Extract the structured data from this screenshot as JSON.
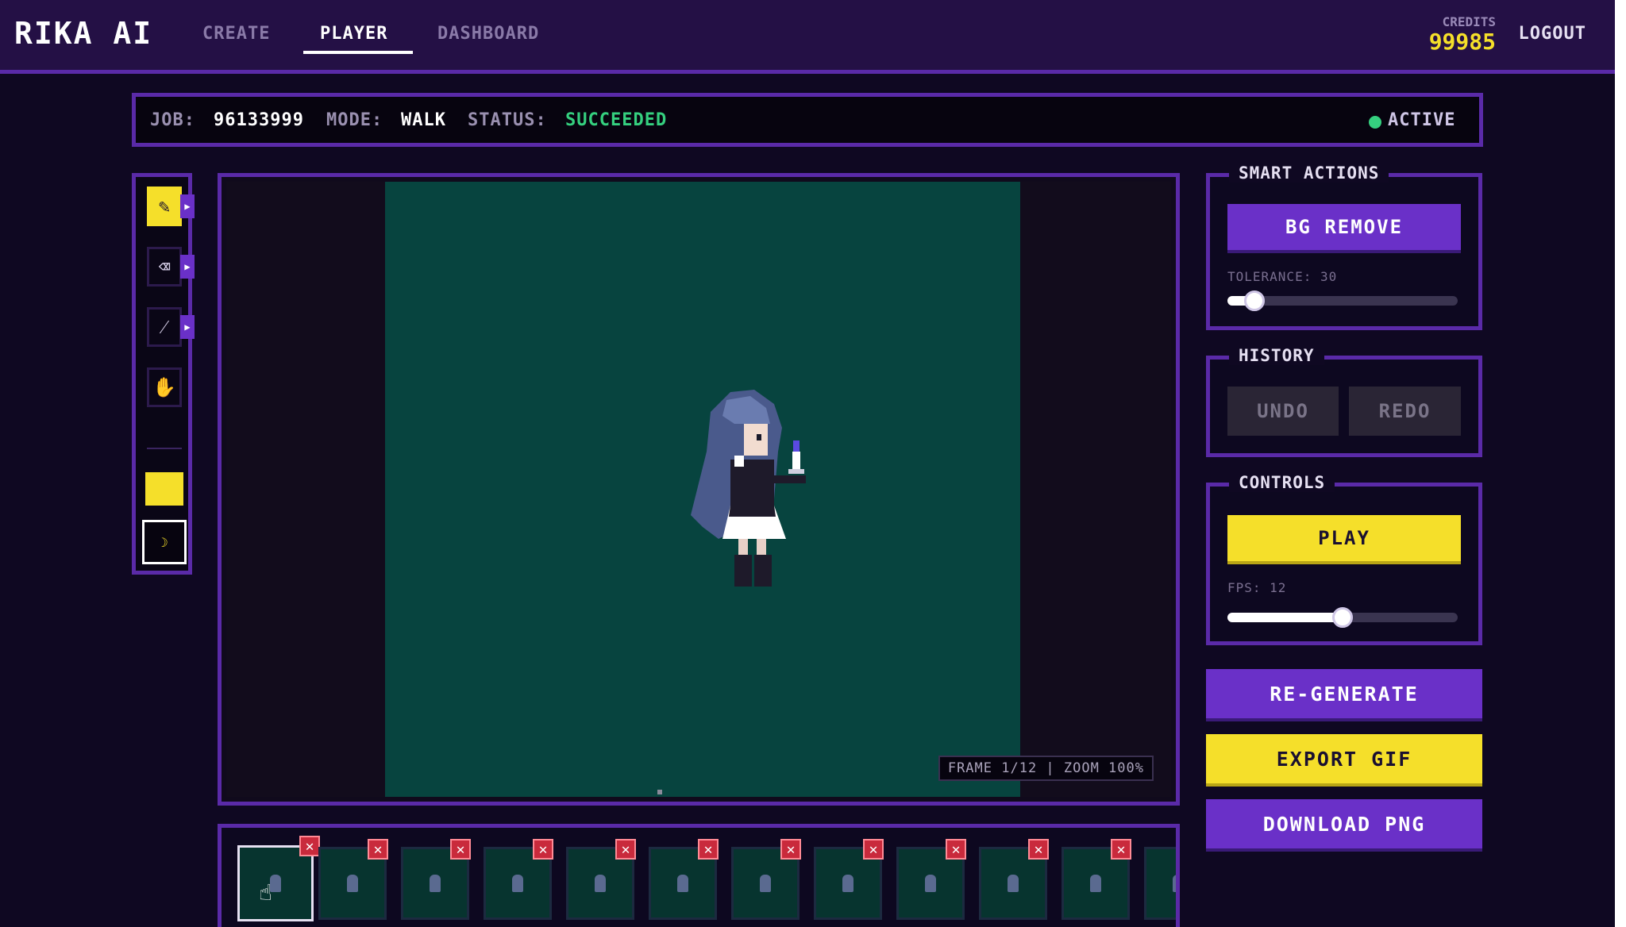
{
  "app": {
    "logo": "RIKA AI"
  },
  "nav": {
    "create": "CREATE",
    "player": "PLAYER",
    "dashboard": "DASHBOARD"
  },
  "account": {
    "credits_label": "CREDITS",
    "credits_value": "99985",
    "logout": "LOGOUT"
  },
  "status": {
    "job_key": "JOB:",
    "job_value": "96133999",
    "mode_key": "MODE:",
    "mode_value": "WALK",
    "status_key": "STATUS:",
    "status_value": "SUCCEEDED",
    "indicator": "ACTIVE"
  },
  "tools": [
    {
      "name": "pencil",
      "icon": "pencil-icon",
      "glyph": "✎",
      "selected": true
    },
    {
      "name": "eraser",
      "icon": "eraser-icon",
      "glyph": "⌫",
      "selected": false
    },
    {
      "name": "magic-wand",
      "icon": "magic-wand-icon",
      "glyph": "⁄",
      "selected": false
    },
    {
      "name": "hand",
      "icon": "hand-icon",
      "glyph": "✋",
      "selected": false
    }
  ],
  "colors": {
    "accent": "#6a30c8",
    "highlight": "#f5df2a",
    "canvas_bg": "#07443f",
    "success": "#35d07f",
    "danger": "#c92a3c"
  },
  "canvas": {
    "frame_info": "FRAME 1/12 | ZOOM 100%"
  },
  "smart_actions": {
    "title": "SMART ACTIONS",
    "bg_remove": "BG REMOVE",
    "tolerance_label": "TOLERANCE: 30",
    "tolerance": 30
  },
  "history": {
    "title": "HISTORY",
    "undo": "UNDO",
    "redo": "REDO"
  },
  "controls": {
    "title": "CONTROLS",
    "play": "PLAY",
    "fps_label": "FPS: 12",
    "fps": 12
  },
  "actions": {
    "regenerate": "RE-GENERATE",
    "export_gif": "EXPORT GIF",
    "download_png": "DOWNLOAD PNG"
  },
  "timeline": {
    "total_frames": 12,
    "current_frame": 1,
    "delete_glyph": "✕"
  }
}
